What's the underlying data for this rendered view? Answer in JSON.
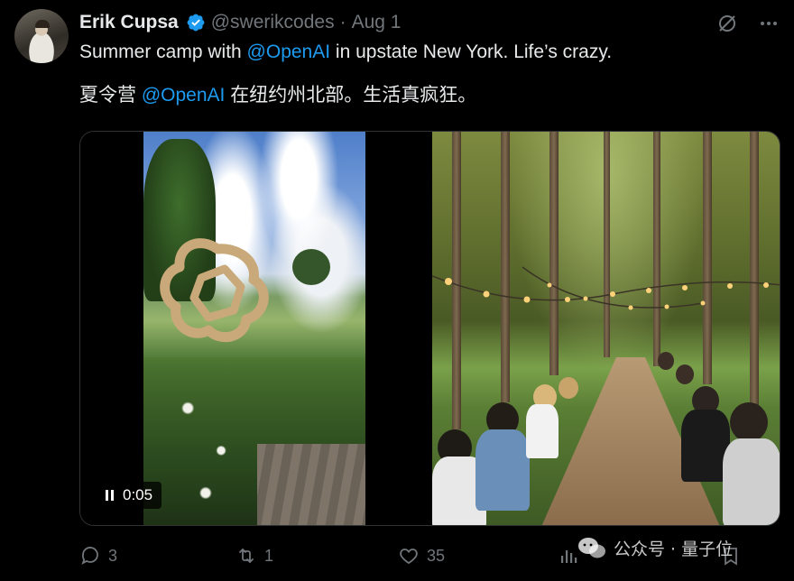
{
  "tweet": {
    "author_name": "Erik Cupsa",
    "handle": "@swerikcodes",
    "separator": "·",
    "date": "Aug 1",
    "text_line1": {
      "prefix": "Summer camp with ",
      "mention": "@OpenAI",
      "suffix": " in upstate New York. Life’s crazy."
    },
    "text_line2": {
      "prefix": "夏令营 ",
      "mention": "@OpenAI",
      "suffix": " 在纽约州北部。生活真疯狂。"
    }
  },
  "media": {
    "video_time": "0:05"
  },
  "actions": {
    "replies": "3",
    "reposts": "1",
    "likes": "35",
    "views_label": "",
    "bookmark": ""
  },
  "watermark": {
    "text": "公众号 · 量子位"
  },
  "colors": {
    "background": "#000000",
    "text": "#e7e9ea",
    "muted": "#71767b",
    "accent": "#1d9bf0"
  }
}
